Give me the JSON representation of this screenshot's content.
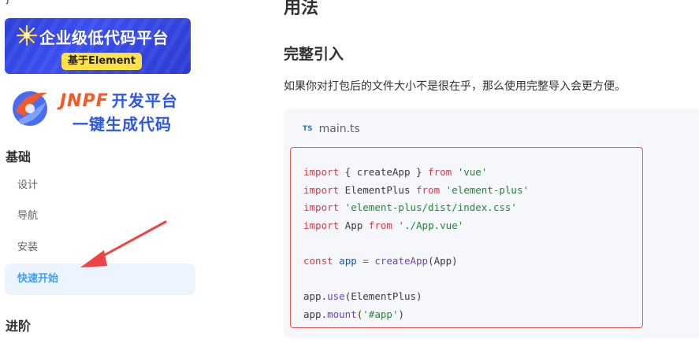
{
  "sidebar": {
    "top_fragment": "}",
    "banner_lowcode": {
      "title": "企业级低代码平台",
      "badge": "基于Element"
    },
    "banner_jnpf": {
      "brand": "JNPF",
      "brand_cn": "开发平台",
      "subtitle": "一键生成代码"
    },
    "groups": [
      {
        "title": "基础",
        "items": [
          {
            "label": "设计",
            "active": false
          },
          {
            "label": "导航",
            "active": false
          },
          {
            "label": "安装",
            "active": false
          },
          {
            "label": "快速开始",
            "active": true
          }
        ]
      },
      {
        "title": "进阶"
      }
    ]
  },
  "main": {
    "section_heading": "用法",
    "subheading": "完整引入",
    "paragraph": "如果你对打包后的文件大小不是很在乎，那么使用完整导入会更方便。",
    "code_block": {
      "lang_badge": "TS",
      "filename": "main.ts",
      "lines": [
        "import { createApp } from 'vue'",
        "import ElementPlus from 'element-plus'",
        "import 'element-plus/dist/index.css'",
        "import App from './App.vue'",
        "",
        "const app = createApp(App)",
        "",
        "app.use(ElementPlus)",
        "app.mount('#app')"
      ]
    }
  },
  "colors": {
    "active_nav_bg": "#ecf5ff",
    "active_nav_text": "#409eff",
    "highlight_border": "#ef5656",
    "annotation_arrow": "#ef4444",
    "code_bg": "#f5f7fa"
  }
}
